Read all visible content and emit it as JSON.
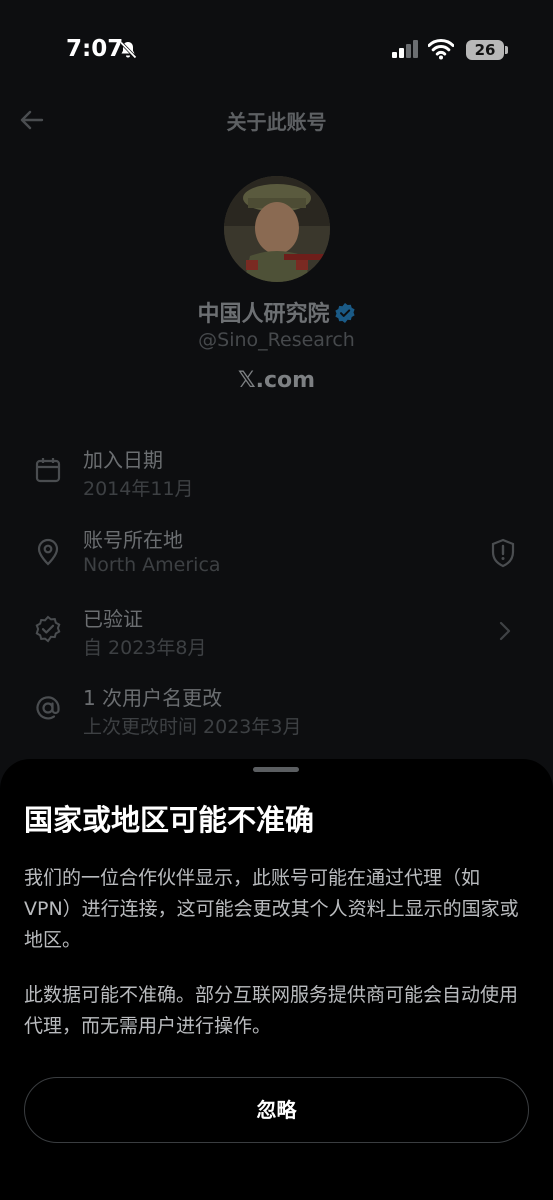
{
  "status": {
    "time": "7:07",
    "battery": "26"
  },
  "header": {
    "title": "关于此账号"
  },
  "profile": {
    "name": "中国人研究院",
    "handle": "@Sino_Research",
    "platform": "𝕏.com"
  },
  "info_rows": [
    {
      "title": "加入日期",
      "sub": "2014年11月",
      "icon": "calendar-icon"
    },
    {
      "title": "账号所在地",
      "sub": "North America",
      "icon": "location-pin-icon"
    },
    {
      "title": "已验证",
      "sub": "自 2023年8月",
      "icon": "verified-check-icon"
    },
    {
      "title": "1 次用户名更改",
      "sub": "上次更改时间 2023年3月",
      "icon": "at-sign-icon"
    }
  ],
  "sheet": {
    "title": "国家或地区可能不准确",
    "para1": "我们的一位合作伙伴显示，此账号可能在通过代理（如 VPN）进行连接，这可能会更改其个人资料上显示的国家或地区。",
    "para2": "此数据可能不准确。部分互联网服务提供商可能会自动使用代理，而无需用户进行操作。",
    "dismiss_label": "忽略"
  },
  "colors": {
    "verified_blue": "#1d9bf0",
    "sheet_bg": "#000000",
    "page_bg": "#0d0e10"
  }
}
